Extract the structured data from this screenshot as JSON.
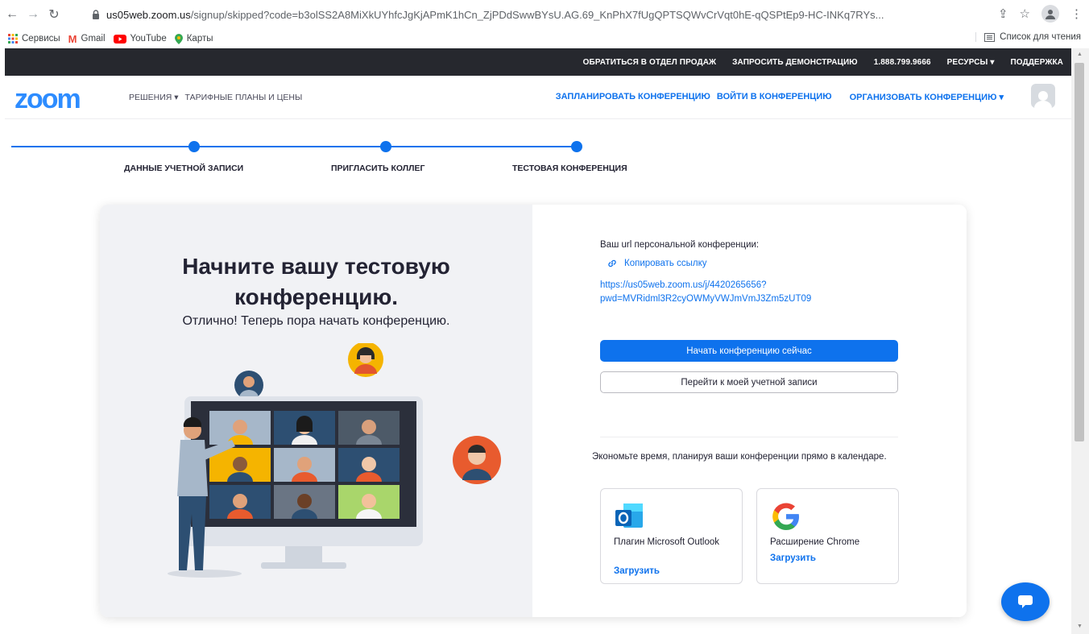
{
  "browser": {
    "url_host": "us05web.zoom.us",
    "url_path": "/signup/skipped?code=b3olSS2A8MiXkUYhfcJgKjAPmK1hCn_ZjPDdSwwBYsU.AG.69_KnPhX7fUgQPTSQWvCrVqt0hE-qQSPtEp9-HC-INKq7RYs...",
    "bookmarks": [
      "Сервисы",
      "Gmail",
      "YouTube",
      "Карты"
    ],
    "reading_list": "Список для чтения"
  },
  "top_bar": {
    "items": [
      "ОБРАТИТЬСЯ В ОТДЕЛ ПРОДАЖ",
      "ЗАПРОСИТЬ ДЕМОНСТРАЦИЮ",
      "1.888.799.9666",
      "РЕСУРСЫ ▾",
      "ПОДДЕРЖКА"
    ]
  },
  "header": {
    "logo": "zoom",
    "nav": [
      "РЕШЕНИЯ ▾",
      "ТАРИФНЫЕ ПЛАНЫ И ЦЕНЫ"
    ],
    "right_nav": [
      "ЗАПЛАНИРОВАТЬ КОНФЕРЕНЦИЮ",
      "ВОЙТИ В КОНФЕРЕНЦИЮ",
      "ОРГАНИЗОВАТЬ КОНФЕРЕНЦИЮ ▾"
    ]
  },
  "steps": [
    "ДАННЫЕ УЧЕТНОЙ ЗАПИСИ",
    "ПРИГЛАСИТЬ КОЛЛЕГ",
    "ТЕСТОВАЯ КОНФЕРЕНЦИЯ"
  ],
  "main": {
    "headline_1": "Начните вашу тестовую",
    "headline_2": "конференцию.",
    "subline": "Отлично! Теперь пора начать конференцию.",
    "url_label": "Ваш url персональной конференции:",
    "copy_link": "Копировать ссылку",
    "url_value_1": "https://us05web.zoom.us/j/4420265656?",
    "url_value_2": "pwd=MVRidml3R2cyOWMyVWJmVmJ3Zm5zUT09",
    "start_button": "Начать конференцию сейчас",
    "account_button": "Перейти к моей учетной записи",
    "save_text": "Экономьте время, планируя ваши конференции прямо в календаре."
  },
  "plugins": [
    {
      "name": "Плагин Microsoft Outlook",
      "download": "Загрузить"
    },
    {
      "name": "Расширение Chrome",
      "download": "Загрузить"
    }
  ],
  "colors": {
    "brand_blue": "#0e72ed",
    "logo_blue": "#2d8cff",
    "top_bar": "#26282e"
  }
}
